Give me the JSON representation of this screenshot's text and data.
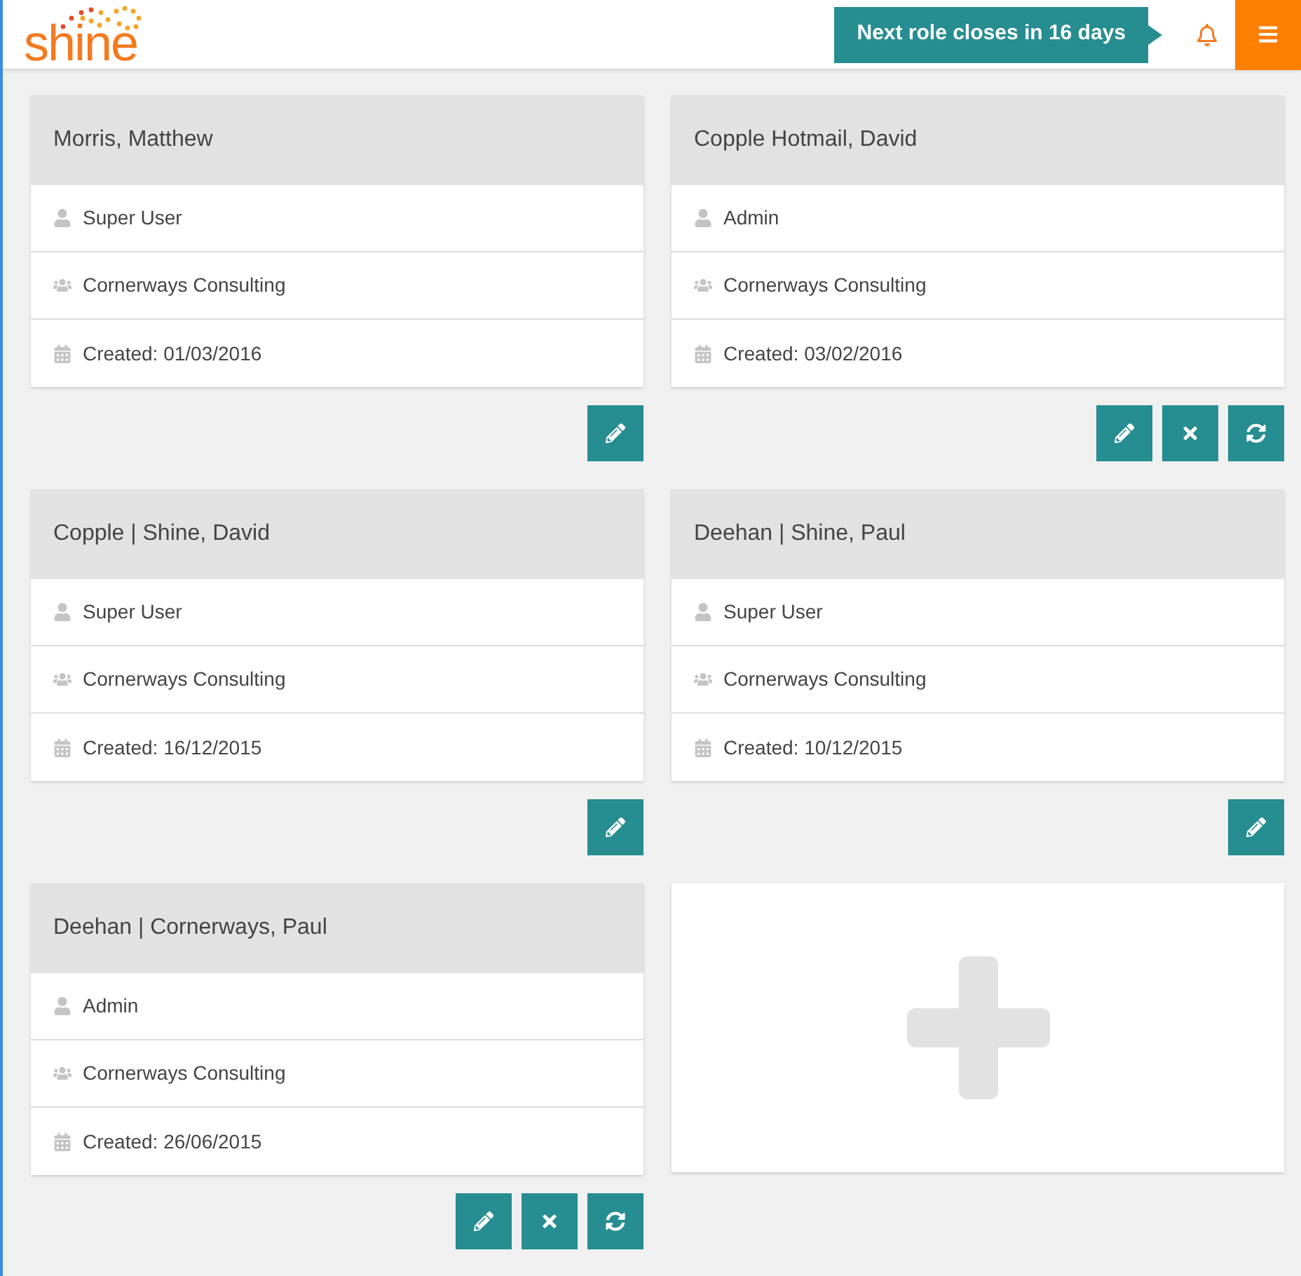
{
  "header": {
    "logo": "shine",
    "notice": "Next role closes in 16 days"
  },
  "users": [
    {
      "name": "Morris, Matthew",
      "role": "Super User",
      "company": "Cornerways Consulting",
      "created": "Created: 01/03/2016",
      "actions": [
        {
          "kind": "edit"
        }
      ]
    },
    {
      "name": "Copple Hotmail, David",
      "role": "Admin",
      "company": "Cornerways Consulting",
      "created": "Created: 03/02/2016",
      "actions": [
        {
          "kind": "edit"
        },
        {
          "kind": "delete"
        },
        {
          "kind": "refresh"
        }
      ]
    },
    {
      "name": "Copple | Shine, David",
      "role": "Super User",
      "company": "Cornerways Consulting",
      "created": "Created: 16/12/2015",
      "actions": [
        {
          "kind": "edit"
        }
      ]
    },
    {
      "name": "Deehan | Shine, Paul",
      "role": "Super User",
      "company": "Cornerways Consulting",
      "created": "Created: 10/12/2015",
      "actions": [
        {
          "kind": "edit"
        }
      ]
    },
    {
      "name": "Deehan | Cornerways, Paul",
      "role": "Admin",
      "company": "Cornerways Consulting",
      "created": "Created: 26/06/2015",
      "actions": [
        {
          "kind": "edit"
        },
        {
          "kind": "delete"
        },
        {
          "kind": "refresh"
        }
      ]
    }
  ],
  "add_card": {
    "kind": "add"
  }
}
